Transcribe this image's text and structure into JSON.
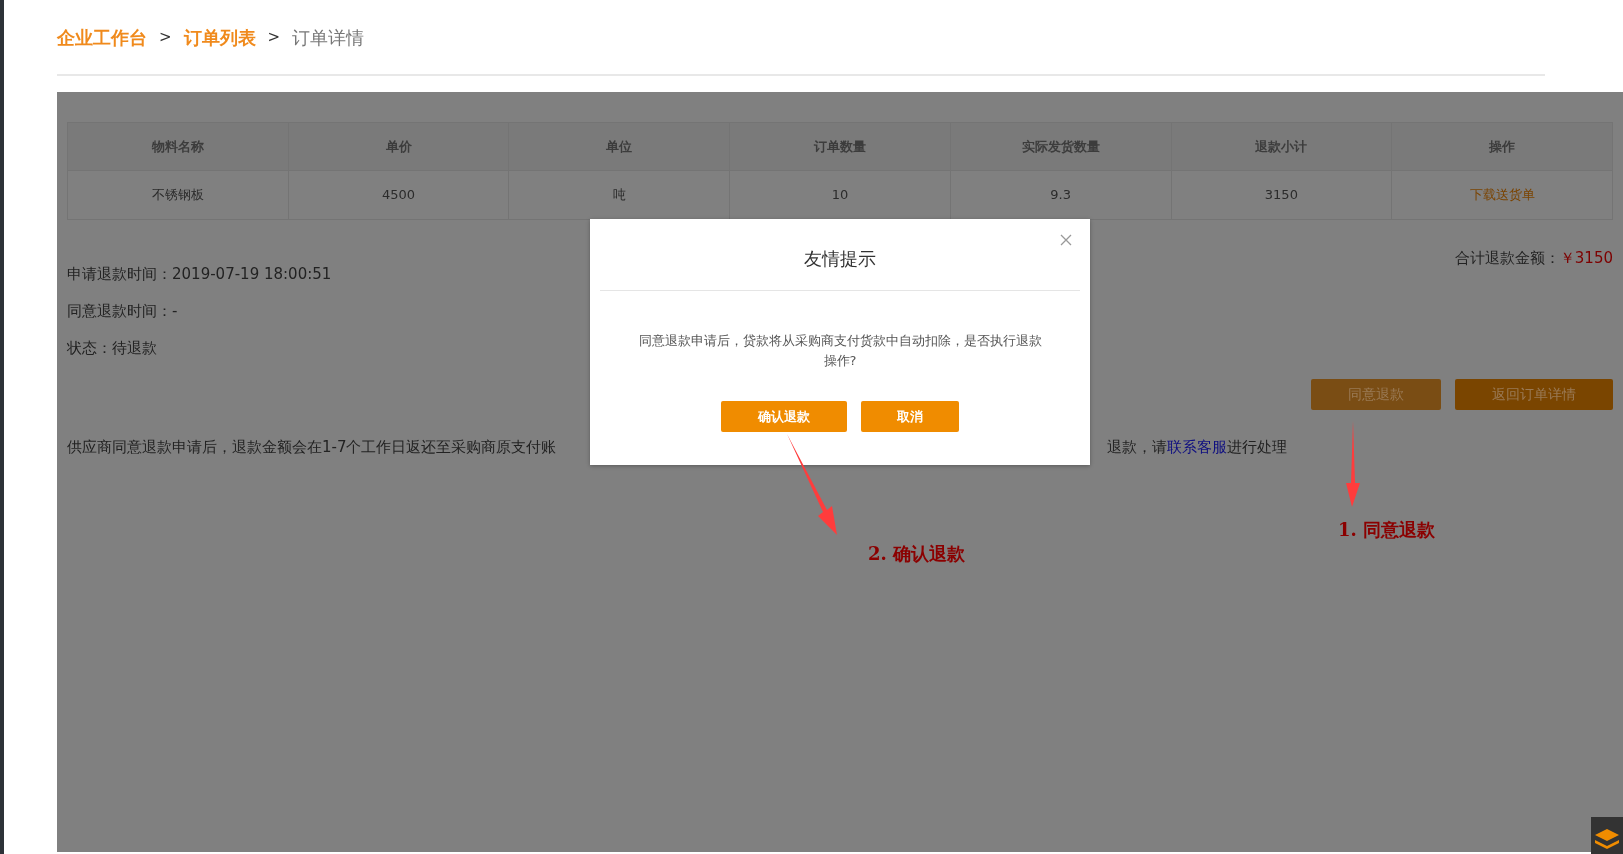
{
  "breadcrumb": [
    {
      "kind": "link",
      "text": "企业工作台"
    },
    {
      "kind": "separator",
      "text": ">"
    },
    {
      "kind": "link",
      "text": "订单列表"
    },
    {
      "kind": "separator",
      "text": ">"
    },
    {
      "kind": "current",
      "text": "订单详情"
    }
  ],
  "table": {
    "columns": [
      "物料名称",
      "单价",
      "单位",
      "订单数量",
      "实际发货数量",
      "退款小计",
      "操作"
    ],
    "rows": [
      {
        "cells": [
          "不锈钢板",
          "4500",
          "吨",
          "10",
          "9.3",
          "3150"
        ],
        "action": "下载送货单"
      }
    ]
  },
  "details": [
    "申请退款时间：2019-07-19 18:00:51",
    "同意退款时间：-",
    "状态：待退款"
  ],
  "total": {
    "label": "合计退款金额：",
    "amount": "￥3150"
  },
  "actions": [
    {
      "kind": "secondary",
      "label": "同意退款"
    },
    {
      "kind": "primary",
      "label": "返回订单详情"
    }
  ],
  "notice": {
    "left": "供应商同意退款申请后，退款金额会在1-7个工作日返还至采购商原支付账",
    "right_before": "退款，请",
    "link": "联系客服",
    "right_after": "进行处理"
  },
  "modal": {
    "title": "友情提示",
    "message": "同意退款申请后，贷款将从采购商支付货款中自动扣除，是否执行退款操作?",
    "buttons": [
      "确认退款",
      "取消"
    ]
  },
  "annotations": [
    {
      "text": "1. 同意退款"
    },
    {
      "text": "2. 确认退款"
    }
  ]
}
